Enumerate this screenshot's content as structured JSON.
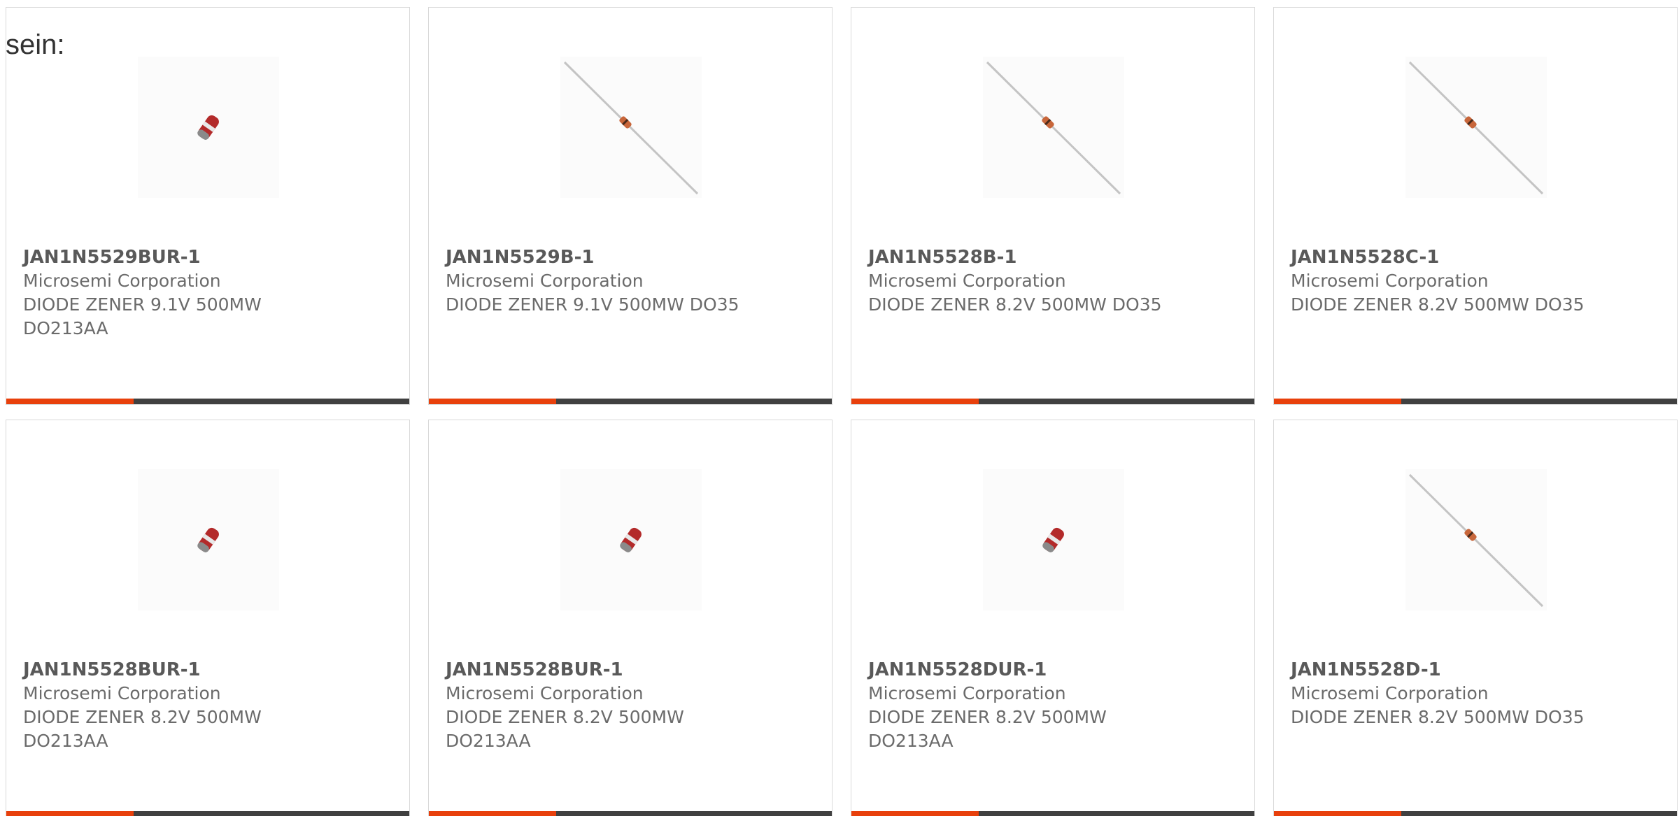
{
  "intro_text": "sein:",
  "colors": {
    "accent": "#e8400c",
    "bar_dark": "#404040",
    "text_dark": "#595959",
    "text_muted": "#6b6b6b"
  },
  "products": [
    {
      "part_number": "JAN1N5529BUR-1",
      "manufacturer": "Microsemi Corporation",
      "description": "DIODE ZENER 9.1V 500MW DO213AA",
      "image_icon": "melf-diode-icon"
    },
    {
      "part_number": "JAN1N5529B-1",
      "manufacturer": "Microsemi Corporation",
      "description": "DIODE ZENER 9.1V 500MW DO35",
      "image_icon": "axial-diode-icon"
    },
    {
      "part_number": "JAN1N5528B-1",
      "manufacturer": "Microsemi Corporation",
      "description": "DIODE ZENER 8.2V 500MW DO35",
      "image_icon": "axial-diode-icon"
    },
    {
      "part_number": "JAN1N5528C-1",
      "manufacturer": "Microsemi Corporation",
      "description": "DIODE ZENER 8.2V 500MW DO35",
      "image_icon": "axial-diode-icon"
    },
    {
      "part_number": "JAN1N5528BUR-1",
      "manufacturer": "Microsemi Corporation",
      "description": "DIODE ZENER 8.2V 500MW DO213AA",
      "image_icon": "melf-diode-icon"
    },
    {
      "part_number": "JAN1N5528BUR-1",
      "manufacturer": "Microsemi Corporation",
      "description": "DIODE ZENER 8.2V 500MW DO213AA",
      "image_icon": "melf-diode-icon"
    },
    {
      "part_number": "JAN1N5528DUR-1",
      "manufacturer": "Microsemi Corporation",
      "description": "DIODE ZENER 8.2V 500MW DO213AA",
      "image_icon": "melf-diode-icon"
    },
    {
      "part_number": "JAN1N5528D-1",
      "manufacturer": "Microsemi Corporation",
      "description": "DIODE ZENER 8.2V 500MW DO35",
      "image_icon": "axial-diode-icon"
    }
  ]
}
